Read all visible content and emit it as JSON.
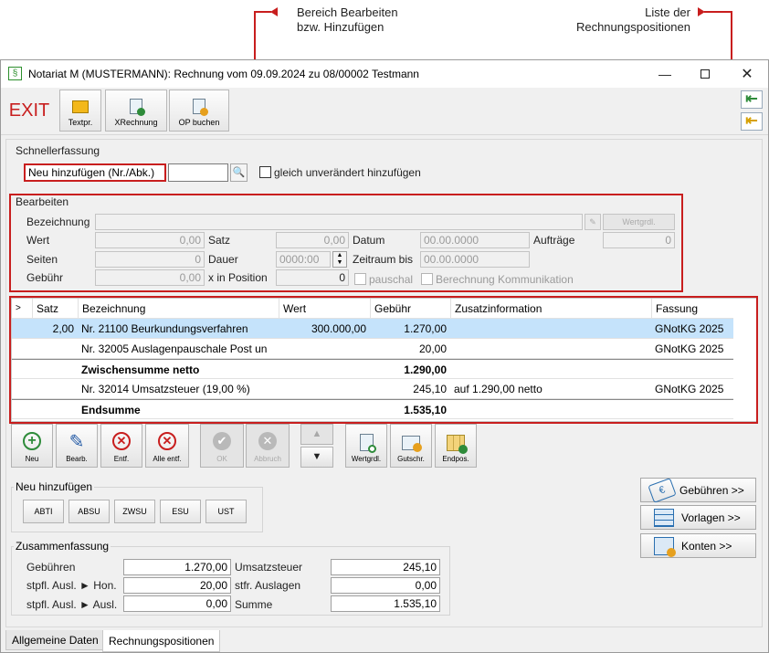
{
  "callouts": {
    "left_line1": "Bereich Bearbeiten",
    "left_line2": "bzw. Hinzufügen",
    "right_line1": "Liste der",
    "right_line2": "Rechnungspositionen"
  },
  "window": {
    "app_icon": "§",
    "title": "Notariat M (MUSTERMANN): Rechnung vom 09.09.2024 zu 08/00002 Testmann"
  },
  "toolbar": {
    "exit": "EXIT",
    "textpr": "Textpr.",
    "xrechnung": "XRechnung",
    "op_buchen": "OP buchen"
  },
  "schnell": {
    "legend": "Schnellerfassung",
    "label": "Neu hinzufügen (Nr./Abk.)",
    "input_value": "",
    "checkbox_label": "gleich unverändert hinzufügen"
  },
  "bearbeiten": {
    "legend": "Bearbeiten",
    "bezeichnung_label": "Bezeichnung",
    "wertgrdl_btn": "Wertgrdl.",
    "wert_label": "Wert",
    "wert_value": "0,00",
    "satz_label": "Satz",
    "satz_value": "0,00",
    "datum_label": "Datum",
    "datum_value": "00.00.0000",
    "auftraege_label": "Aufträge",
    "auftraege_value": "0",
    "seiten_label": "Seiten",
    "seiten_value": "0",
    "dauer_label": "Dauer",
    "dauer_value": "0000:00",
    "zeitraum_label": "Zeitraum bis",
    "zeitraum_value": "00.00.0000",
    "gebuehr_label": "Gebühr",
    "gebuehr_value": "0,00",
    "xinpos_label": "x in Position",
    "xinpos_value": "0",
    "pauschal_label": "pauschal",
    "komm_label": "Berechnung Kommunikation"
  },
  "grid": {
    "headers": [
      ">",
      "Satz",
      "Bezeichnung",
      "Wert",
      "Gebühr",
      "Zusatzinformation",
      "Fassung"
    ],
    "rows": [
      {
        "satz": "2,00",
        "bez": "Nr. 21100 Beurkundungsverfahren",
        "wert": "300.000,00",
        "gebuehr": "1.270,00",
        "zusatz": "",
        "fassung": "GNotKG 2025"
      },
      {
        "satz": "",
        "bez": "Nr. 32005 Auslagenpauschale Post un",
        "wert": "",
        "gebuehr": "20,00",
        "zusatz": "",
        "fassung": "GNotKG 2025"
      },
      {
        "satz": "",
        "bez": "Zwischensumme netto",
        "wert": "",
        "gebuehr": "1.290,00",
        "zusatz": "",
        "fassung": ""
      },
      {
        "satz": "",
        "bez": "Nr. 32014 Umsatzsteuer (19,00 %)",
        "wert": "",
        "gebuehr": "245,10",
        "zusatz": "auf 1.290,00 netto",
        "fassung": "GNotKG 2025"
      },
      {
        "satz": "",
        "bez": "Endsumme",
        "wert": "",
        "gebuehr": "1.535,10",
        "zusatz": "",
        "fassung": ""
      }
    ]
  },
  "actions": {
    "neu": "Neu",
    "bearb": "Bearb.",
    "entf": "Entf.",
    "alle_entf": "Alle entf.",
    "ok": "OK",
    "abbruch": "Abbruch",
    "wertgrdl": "Wertgrdl.",
    "gutschr": "Gutschr.",
    "endpos": "Endpos."
  },
  "neu_hinzufuegen": {
    "legend": "Neu hinzufügen",
    "buttons": [
      "ABTI",
      "ABSU",
      "ZWSU",
      "ESU",
      "UST"
    ]
  },
  "side": {
    "gebuehren": "Gebühren >>",
    "vorlagen": "Vorlagen >>",
    "konten": "Konten >>"
  },
  "zusammen": {
    "legend": "Zusammenfassung",
    "gebuehren_label": "Gebühren",
    "gebuehren_value": "1.270,00",
    "ust_label": "Umsatzsteuer",
    "ust_value": "245,10",
    "stpfl_hon_label": "stpfl. Ausl. ► Hon.",
    "stpfl_hon_value": "20,00",
    "stfr_label": "stfr. Auslagen",
    "stfr_value": "0,00",
    "stpfl_ausl_label": "stpfl. Ausl. ► Ausl.",
    "stpfl_ausl_value": "0,00",
    "summe_label": "Summe",
    "summe_value": "1.535,10"
  },
  "tabs": [
    "Allgemeine Daten",
    "Rechnungspositionen"
  ],
  "colors": {
    "accent_red": "#c81e1e",
    "selected_row": "#c5e3fb",
    "exit_red": "#c81e1e"
  }
}
